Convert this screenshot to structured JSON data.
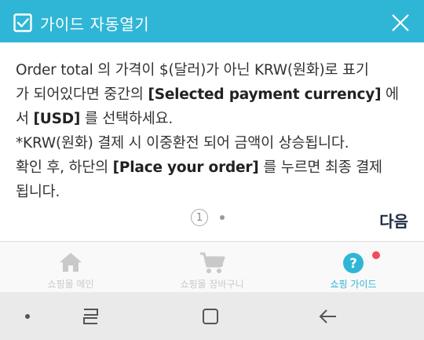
{
  "header": {
    "title": "가이드 자동열기",
    "bg_color": "#2fb6d6"
  },
  "guide": {
    "lines": [
      [
        {
          "text": "Order total 의 가격이 $(달러)가 아닌 KRW(원화)로 표기",
          "bold": false
        }
      ],
      [
        {
          "text": "가 되어있다면 중간의 ",
          "bold": false
        },
        {
          "text": "[Selected payment currency]",
          "bold": true
        },
        {
          "text": " 에",
          "bold": false
        }
      ],
      [
        {
          "text": "서 ",
          "bold": false
        },
        {
          "text": "[USD]",
          "bold": true
        },
        {
          "text": " 를 선택하세요.",
          "bold": false
        }
      ],
      [
        {
          "text": "*KRW(원화) 결제 시 이중환전 되어 금액이 상승됩니다.",
          "bold": false
        }
      ],
      [
        {
          "text": "확인 후, 하단의 ",
          "bold": false
        },
        {
          "text": "[Place your order]",
          "bold": true
        },
        {
          "text": " 를 누르면 최종 결제",
          "bold": false
        }
      ],
      [
        {
          "text": "됩니다.",
          "bold": false
        }
      ]
    ]
  },
  "pager": {
    "current": "1",
    "next_label": "다음"
  },
  "nav": {
    "items": [
      {
        "label": "쇼핑몰 메인",
        "icon": "home-icon"
      },
      {
        "label": "쇼핑몰 장바구니",
        "icon": "cart-icon"
      },
      {
        "label": "쇼핑 가이드",
        "icon": "help-icon"
      }
    ],
    "active_color": "#2fb6d6",
    "badge_color": "#f24a5c"
  },
  "system_bar": {
    "buttons": [
      "dot-icon",
      "recents-icon",
      "home-square-icon",
      "back-arrow-icon"
    ]
  }
}
